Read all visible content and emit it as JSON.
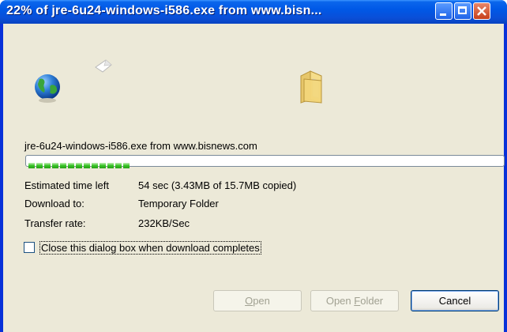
{
  "window": {
    "title": "22% of jre-6u24-windows-i586.exe from www.bisn...",
    "progress_percent": 22
  },
  "icons": [
    "globe-icon",
    "flying-paper-icon",
    "folder-icon"
  ],
  "download": {
    "file_line": "jre-6u24-windows-i586.exe from www.bisnews.com",
    "estimated_label": "Estimated time left",
    "estimated_value": "54 sec (3.43MB of 15.7MB copied)",
    "download_to_label": "Download to:",
    "download_to_value": "Temporary Folder",
    "rate_label": "Transfer rate:",
    "rate_value": "232KB/Sec"
  },
  "checkbox": {
    "label": "Close this dialog box when download completes",
    "checked": false
  },
  "buttons": {
    "open_mnemonic": "O",
    "open_rest": "pen",
    "open_folder_prefix": "Open ",
    "open_folder_mnemonic": "F",
    "open_folder_rest": "older",
    "cancel": "Cancel"
  }
}
